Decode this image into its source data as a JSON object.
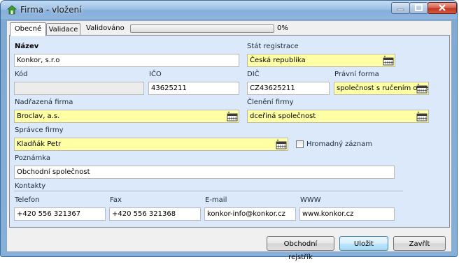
{
  "window": {
    "title": "Firma - vložení"
  },
  "tabs": [
    {
      "label": "Obecné",
      "active": true
    },
    {
      "label": "Validace",
      "active": false
    }
  ],
  "validation": {
    "label": "Validováno",
    "progress": 0,
    "progress_text": "0%"
  },
  "form": {
    "nazev": {
      "label": "Název",
      "value": "Konkor, s.r.o"
    },
    "stat": {
      "label": "Stát registrace",
      "value": "Česká republika"
    },
    "kod": {
      "label": "Kód",
      "value": ""
    },
    "ico": {
      "label": "IČO",
      "value": "43625211"
    },
    "dic": {
      "label": "DIČ",
      "value": "CZ43625211"
    },
    "pravni_forma": {
      "label": "Právní forma",
      "value": "společnost s ručením omezeným"
    },
    "nadrazena": {
      "label": "Nadřazená firma",
      "value": "Broclav, a.s."
    },
    "cleneni": {
      "label": "Členění firmy",
      "value": "dceřiná společnost"
    },
    "spravce": {
      "label": "Správce firmy",
      "value": "Kladňák Petr"
    },
    "hromadny": {
      "label": "Hromadný záznam",
      "checked": false
    },
    "poznamka": {
      "label": "Poznámka",
      "value": "Obchodní společnost"
    },
    "kontakty": {
      "label": "Kontakty"
    },
    "telefon": {
      "label": "Telefon",
      "value": "+420 556 321367"
    },
    "fax": {
      "label": "Fax",
      "value": "+420 556 321368"
    },
    "email": {
      "label": "E-mail",
      "value": "konkor-info@konkor.cz"
    },
    "www": {
      "label": "WWW",
      "value": "www.konkor.cz"
    }
  },
  "buttons": {
    "rejstrik": "Obchodní rejstřík",
    "ulozit": "Uložit",
    "zavrit": "Zavřít"
  },
  "colors": {
    "required_field": "#ffffa6",
    "panel": "#dbe9fa",
    "title_bar": "#9dc1e5"
  },
  "icons": {
    "app": "house-icon",
    "picker": "table-picker-icon"
  }
}
